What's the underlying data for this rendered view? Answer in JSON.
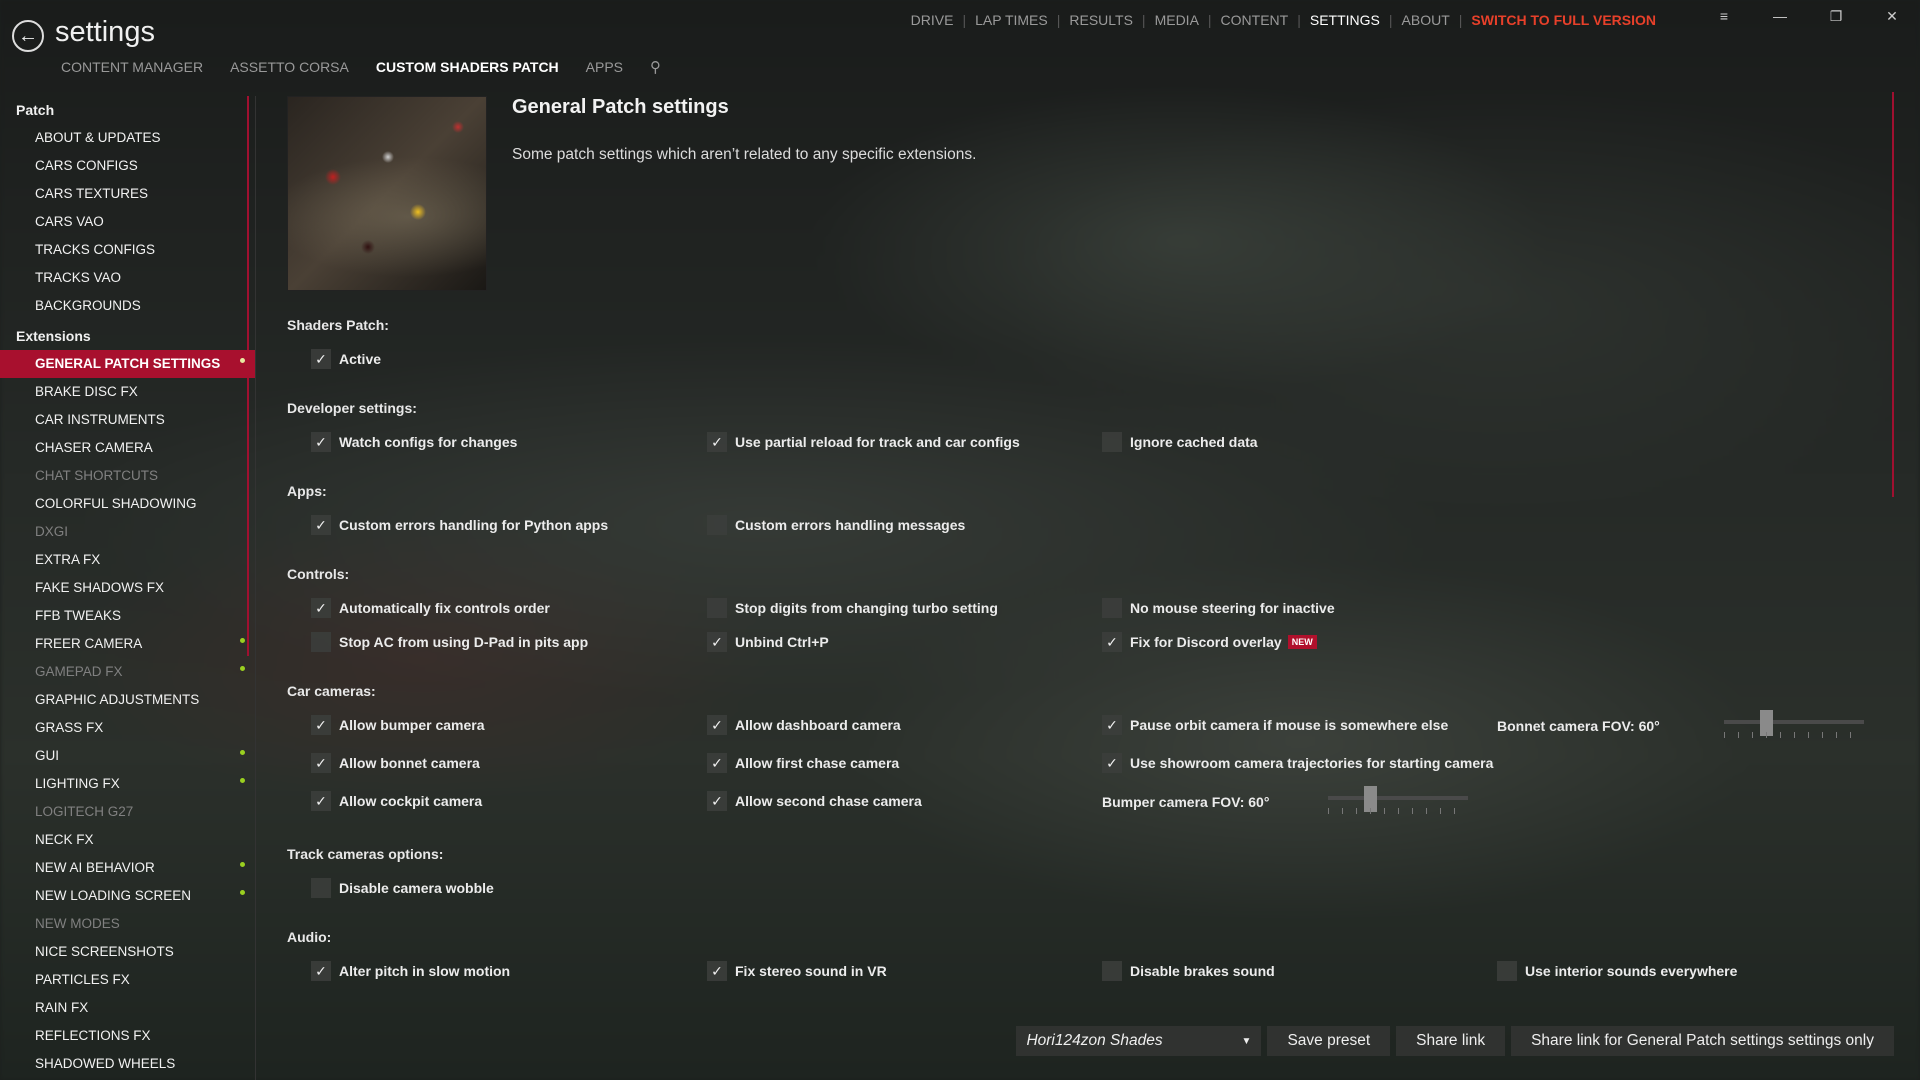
{
  "header": {
    "title": "settings",
    "top_nav": [
      {
        "label": "DRIVE"
      },
      {
        "label": "LAP TIMES"
      },
      {
        "label": "RESULTS"
      },
      {
        "label": "MEDIA"
      },
      {
        "label": "CONTENT"
      },
      {
        "label": "SETTINGS"
      },
      {
        "label": "ABOUT"
      },
      {
        "label": "SWITCH TO FULL VERSION"
      }
    ],
    "sub_nav": [
      {
        "label": "CONTENT MANAGER"
      },
      {
        "label": "ASSETTO CORSA"
      },
      {
        "label": "CUSTOM SHADERS PATCH"
      },
      {
        "label": "APPS"
      }
    ],
    "window_controls": {
      "menu": "≡",
      "minimize": "—",
      "restore": "❐",
      "close": "✕"
    }
  },
  "sidebar": {
    "group_patch": "Patch",
    "patch_items": [
      {
        "label": "ABOUT & UPDATES"
      },
      {
        "label": "CARS CONFIGS"
      },
      {
        "label": "CARS TEXTURES"
      },
      {
        "label": "CARS VAO"
      },
      {
        "label": "TRACKS CONFIGS"
      },
      {
        "label": "TRACKS VAO"
      },
      {
        "label": "BACKGROUNDS"
      }
    ],
    "group_extensions": "Extensions",
    "extension_items": [
      {
        "label": "GENERAL PATCH SETTINGS"
      },
      {
        "label": "BRAKE DISC FX"
      },
      {
        "label": "CAR INSTRUMENTS"
      },
      {
        "label": "CHASER CAMERA"
      },
      {
        "label": "CHAT SHORTCUTS"
      },
      {
        "label": "COLORFUL SHADOWING"
      },
      {
        "label": "DXGI"
      },
      {
        "label": "EXTRA FX"
      },
      {
        "label": "FAKE SHADOWS FX"
      },
      {
        "label": "FFB TWEAKS"
      },
      {
        "label": "FREER CAMERA"
      },
      {
        "label": "GAMEPAD FX"
      },
      {
        "label": "GRAPHIC ADJUSTMENTS"
      },
      {
        "label": "GRASS FX"
      },
      {
        "label": "GUI"
      },
      {
        "label": "LIGHTING FX"
      },
      {
        "label": "LOGITECH G27"
      },
      {
        "label": "NECK FX"
      },
      {
        "label": "NEW AI BEHAVIOR"
      },
      {
        "label": "NEW LOADING SCREEN"
      },
      {
        "label": "NEW MODES"
      },
      {
        "label": "NICE SCREENSHOTS"
      },
      {
        "label": "PARTICLES FX"
      },
      {
        "label": "RAIN FX"
      },
      {
        "label": "REFLECTIONS FX"
      },
      {
        "label": "SHADOWED WHEELS"
      }
    ]
  },
  "main": {
    "title": "General Patch settings",
    "description": "Some patch settings which aren’t related to any specific extensions.",
    "sections": {
      "shaders_patch": "Shaders Patch:",
      "developer": "Developer settings:",
      "apps": "Apps:",
      "controls": "Controls:",
      "car_cameras": "Car cameras:",
      "track_cameras": "Track cameras options:",
      "audio": "Audio:"
    },
    "checkboxes": {
      "active": "Active",
      "watch_configs": "Watch configs for changes",
      "partial_reload": "Use partial reload for track and car configs",
      "ignore_cached": "Ignore cached data",
      "custom_errors_python": "Custom errors handling for Python apps",
      "custom_errors_messages": "Custom errors handling messages",
      "auto_fix_controls": "Automatically fix controls order",
      "stop_digits": "Stop digits from changing turbo setting",
      "no_mouse_steering": "No mouse steering for inactive",
      "stop_dpad": "Stop AC from using D-Pad in pits app",
      "unbind_ctrlp": "Unbind Ctrl+P",
      "fix_discord": "Fix for Discord overlay",
      "allow_bumper": "Allow bumper camera",
      "allow_dashboard": "Allow dashboard camera",
      "pause_orbit": "Pause orbit camera if mouse is somewhere else",
      "allow_bonnet": "Allow bonnet camera",
      "allow_first_chase": "Allow first chase camera",
      "use_showroom": "Use showroom camera trajectories for starting camera",
      "allow_cockpit": "Allow cockpit camera",
      "allow_second_chase": "Allow second chase camera",
      "disable_wobble": "Disable camera wobble",
      "alter_pitch": "Alter pitch in slow motion",
      "fix_stereo": "Fix stereo sound in VR",
      "disable_brakes": "Disable brakes sound",
      "interior_sounds": "Use interior sounds everywhere"
    },
    "badge_new": "NEW",
    "sliders": {
      "bonnet_fov_label": "Bonnet camera FOV: 60°",
      "bumper_fov_label": "Bumper camera FOV: 60°",
      "bonnet_fov_value": 0.28,
      "bumper_fov_value": 0.28
    }
  },
  "bottom": {
    "preset": "Hori124zon Shades",
    "save_preset": "Save preset",
    "share_link": "Share link",
    "share_link_only": "Share link for General Patch settings settings only"
  },
  "colors": {
    "accent": "#a8102e",
    "full_version": "#e8402a",
    "active_dot": "#9ad020"
  }
}
